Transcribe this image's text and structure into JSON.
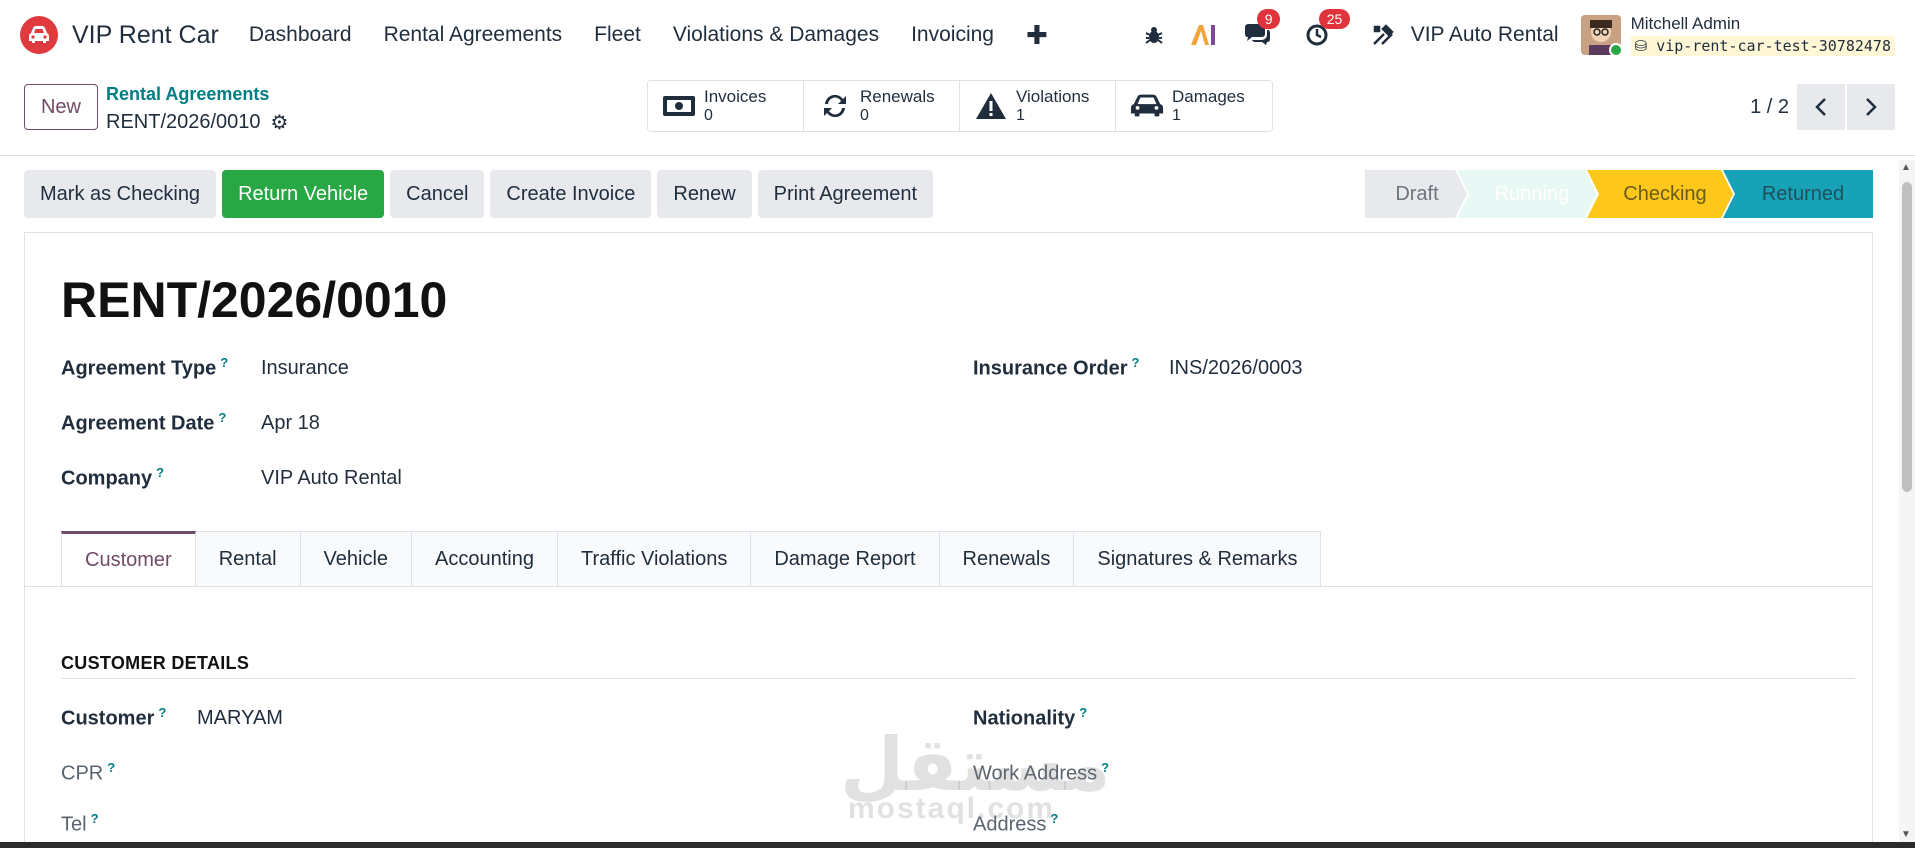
{
  "app": {
    "name": "VIP Rent Car"
  },
  "nav": {
    "items": [
      "Dashboard",
      "Rental Agreements",
      "Fleet",
      "Violations & Damages",
      "Invoicing"
    ],
    "plus": "✚"
  },
  "systray": {
    "messages_count": "9",
    "activities_count": "25",
    "company": "VIP Auto Rental",
    "user_name": "Mitchell Admin",
    "database": "vip-rent-car-test-30782478",
    "ai_label": "AI"
  },
  "control": {
    "new_label": "New",
    "breadcrumb": "Rental Agreements",
    "record": "RENT/2026/0010",
    "pager": "1 / 2",
    "smart_buttons": [
      {
        "label": "Invoices",
        "value": "0",
        "icon": "money-icon"
      },
      {
        "label": "Renewals",
        "value": "0",
        "icon": "refresh-icon"
      },
      {
        "label": "Violations",
        "value": "1",
        "icon": "warning-icon"
      },
      {
        "label": "Damages",
        "value": "1",
        "icon": "car-icon"
      }
    ]
  },
  "actions": [
    "Mark as Checking",
    "Return Vehicle",
    "Cancel",
    "Create Invoice",
    "Renew",
    "Print Agreement"
  ],
  "stages": [
    "Draft",
    "Running",
    "Checking",
    "Returned"
  ],
  "active_stage": "Checking",
  "colors": {
    "brand": "#714b67",
    "accent_teal": "#017e84",
    "primary_green": "#28a745",
    "checking_yellow": "#fdc81b",
    "returned_cyan": "#17a2b8"
  },
  "form": {
    "title": "RENT/2026/0010",
    "fields": {
      "agreement_type": {
        "label": "Agreement Type",
        "value": "Insurance"
      },
      "agreement_date": {
        "label": "Agreement Date",
        "value": "Apr 18"
      },
      "company": {
        "label": "Company",
        "value": "VIP Auto Rental"
      },
      "insurance_order": {
        "label": "Insurance Order",
        "value": "INS/2026/0003"
      }
    },
    "tabs": [
      "Customer",
      "Rental",
      "Vehicle",
      "Accounting",
      "Traffic Violations",
      "Damage Report",
      "Renewals",
      "Signatures & Remarks"
    ],
    "active_tab": "Customer",
    "customer_section": {
      "title": "CUSTOMER DETAILS",
      "customer": {
        "label": "Customer",
        "value": "MARYAM"
      },
      "cpr": {
        "label": "CPR"
      },
      "tel": {
        "label": "Tel"
      },
      "nationality": {
        "label": "Nationality"
      },
      "work_address": {
        "label": "Work Address"
      },
      "address": {
        "label": "Address"
      }
    }
  },
  "watermark": {
    "text": "مستقل",
    "sub": "mostaql.com"
  },
  "help_mark": "?"
}
